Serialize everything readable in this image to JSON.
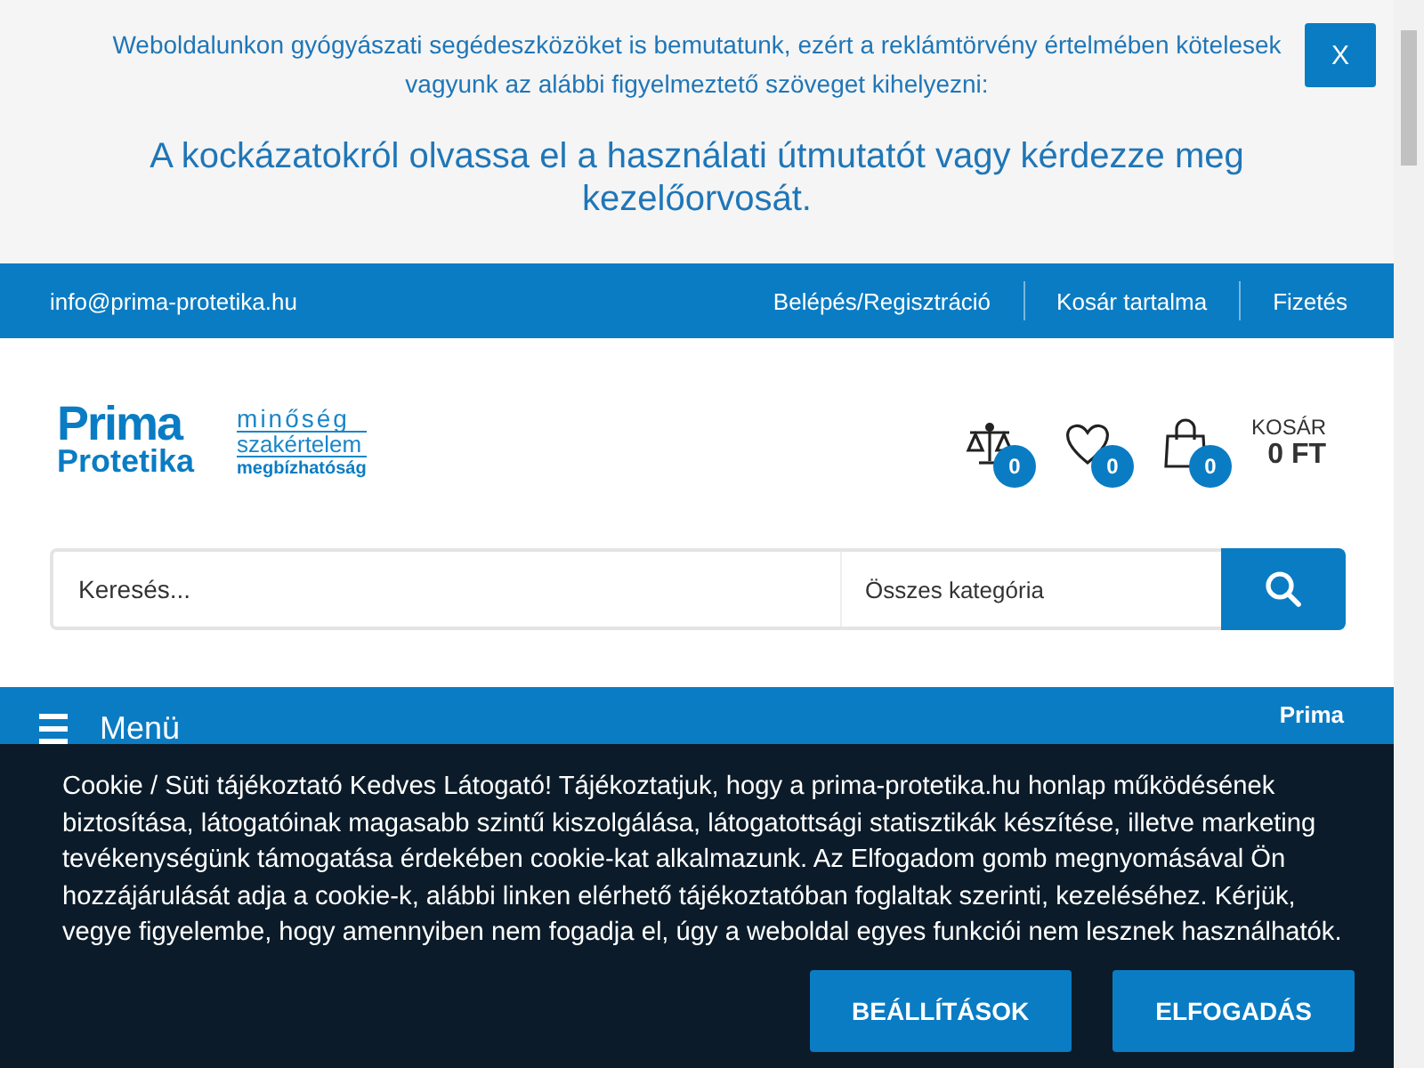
{
  "notice": {
    "text": "Weboldalunkon gyógyászati segédeszközöket is bemutatunk, ezért a reklámtörvény értelmében kötelesek vagyunk az alábbi figyelmeztető szöveget kihelyezni:",
    "warning": "A kockázatokról olvassa el a használati útmutatót vagy kérdezze meg kezelőorvosát.",
    "close_label": "X"
  },
  "top_bar": {
    "email": "info@prima-protetika.hu",
    "links": [
      "Belépés/Regisztráció",
      "Kosár tartalma",
      "Fizetés"
    ]
  },
  "header": {
    "logo": [
      "Prima",
      "Protetika"
    ],
    "tagline": [
      "minőség",
      "szakértelem",
      "megbízhatóság"
    ],
    "counters": [
      {
        "kind": "compare",
        "count": "0"
      },
      {
        "kind": "wishlist",
        "count": "0"
      },
      {
        "kind": "cart",
        "count": "0"
      }
    ],
    "cart_label": "KOSÁR",
    "cart_total": "0 FT"
  },
  "search": {
    "placeholder": "Keresés...",
    "category": "Összes kategória"
  },
  "menu_bar": {
    "label": "Menü",
    "logo": [
      "Prima"
    ]
  },
  "cookie": {
    "text": "Cookie / Süti tájékoztató Kedves Látogató! Tájékoztatjuk, hogy a prima-protetika.hu honlap működésének biztosítása, látogatóinak magasabb szintű kiszolgálása, látogatottsági statisztikák készítése, illetve marketing tevékenységünk támogatása érdekében cookie-kat alkalmazunk. Az Elfogadom gomb megnyomásával Ön hozzájárulását adja a cookie-k, alábbi linken elérhető tájékoztatóban foglaltak szerinti, kezeléséhez. Kérjük, vegye figyelembe, hogy amennyiben nem fogadja el, úgy a weboldal egyes funkciói nem lesznek használhatók.",
    "buttons": [
      "BEÁLLÍTÁSOK",
      "ELFOGADÁS"
    ]
  }
}
